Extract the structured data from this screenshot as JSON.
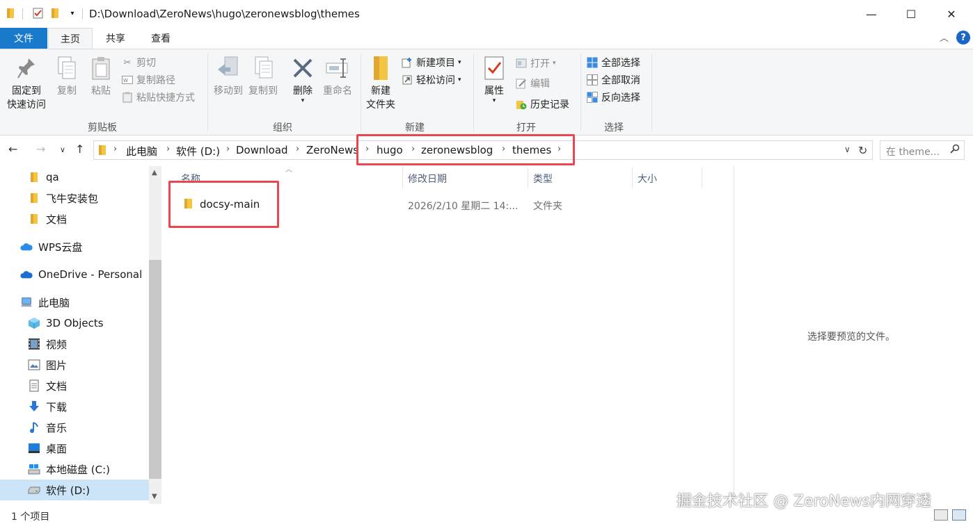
{
  "window": {
    "title": "D:\\Download\\ZeroNews\\hugo\\zeronewsblog\\themes",
    "minimize": "—",
    "maximize": "☐",
    "close": "✕"
  },
  "tabs": [
    {
      "label": "文件"
    },
    {
      "label": "主页"
    },
    {
      "label": "共享"
    },
    {
      "label": "查看"
    }
  ],
  "help": "?",
  "ribbon": {
    "clipboard": {
      "label": "剪贴板",
      "pin_line1": "固定到",
      "pin_line2": "快速访问",
      "copy": "复制",
      "paste": "粘贴",
      "cut": "剪切",
      "copy_path": "复制路径",
      "paste_shortcut": "粘贴快捷方式"
    },
    "organize": {
      "label": "组织",
      "move_to": "移动到",
      "copy_to": "复制到",
      "delete": "删除",
      "rename": "重命名"
    },
    "new": {
      "label": "新建",
      "new_folder_line1": "新建",
      "new_folder_line2": "文件夹",
      "new_item": "新建项目",
      "easy_access": "轻松访问"
    },
    "open": {
      "label": "打开",
      "properties": "属性",
      "open": "打开",
      "edit": "编辑",
      "history": "历史记录"
    },
    "select": {
      "label": "选择",
      "select_all": "全部选择",
      "select_none": "全部取消",
      "invert": "反向选择"
    }
  },
  "breadcrumb": [
    "此电脑",
    "软件 (D:)",
    "Download",
    "ZeroNews",
    "hugo",
    "zeronewsblog",
    "themes"
  ],
  "search": {
    "placeholder": "在 theme..."
  },
  "sidebar": {
    "items": [
      {
        "label": "qa",
        "icon": "folder-icon"
      },
      {
        "label": "飞牛安装包",
        "icon": "folder-icon"
      },
      {
        "label": "文档",
        "icon": "folder-icon"
      },
      {
        "label": "WPS云盘",
        "icon": "cloud-icon"
      },
      {
        "label": "OneDrive - Personal",
        "icon": "cloud-icon"
      },
      {
        "label": "此电脑",
        "icon": "computer-icon"
      },
      {
        "label": "3D Objects",
        "icon": "cube-icon"
      },
      {
        "label": "视频",
        "icon": "video-icon"
      },
      {
        "label": "图片",
        "icon": "picture-icon"
      },
      {
        "label": "文档",
        "icon": "document-icon"
      },
      {
        "label": "下载",
        "icon": "download-icon"
      },
      {
        "label": "音乐",
        "icon": "music-icon"
      },
      {
        "label": "桌面",
        "icon": "desktop-icon"
      },
      {
        "label": "本地磁盘 (C:)",
        "icon": "drive-icon"
      },
      {
        "label": "软件 (D:)",
        "icon": "drive-icon",
        "selected": true
      }
    ]
  },
  "columns": {
    "name": "名称",
    "modified": "修改日期",
    "type": "类型",
    "size": "大小"
  },
  "files": [
    {
      "name": "docsy-main",
      "modified": "2026/2/10 星期二 14:...",
      "type": "文件夹"
    }
  ],
  "preview": {
    "message": "选择要预览的文件。"
  },
  "status": {
    "count": "1 个项目"
  },
  "watermark": "掘金技术社区 @ ZeroNews内网穿透",
  "colors": {
    "file_tab": "#1979ca",
    "highlight": "#e8474f",
    "selection": "#cce4f7",
    "folder": "#f4c542"
  }
}
